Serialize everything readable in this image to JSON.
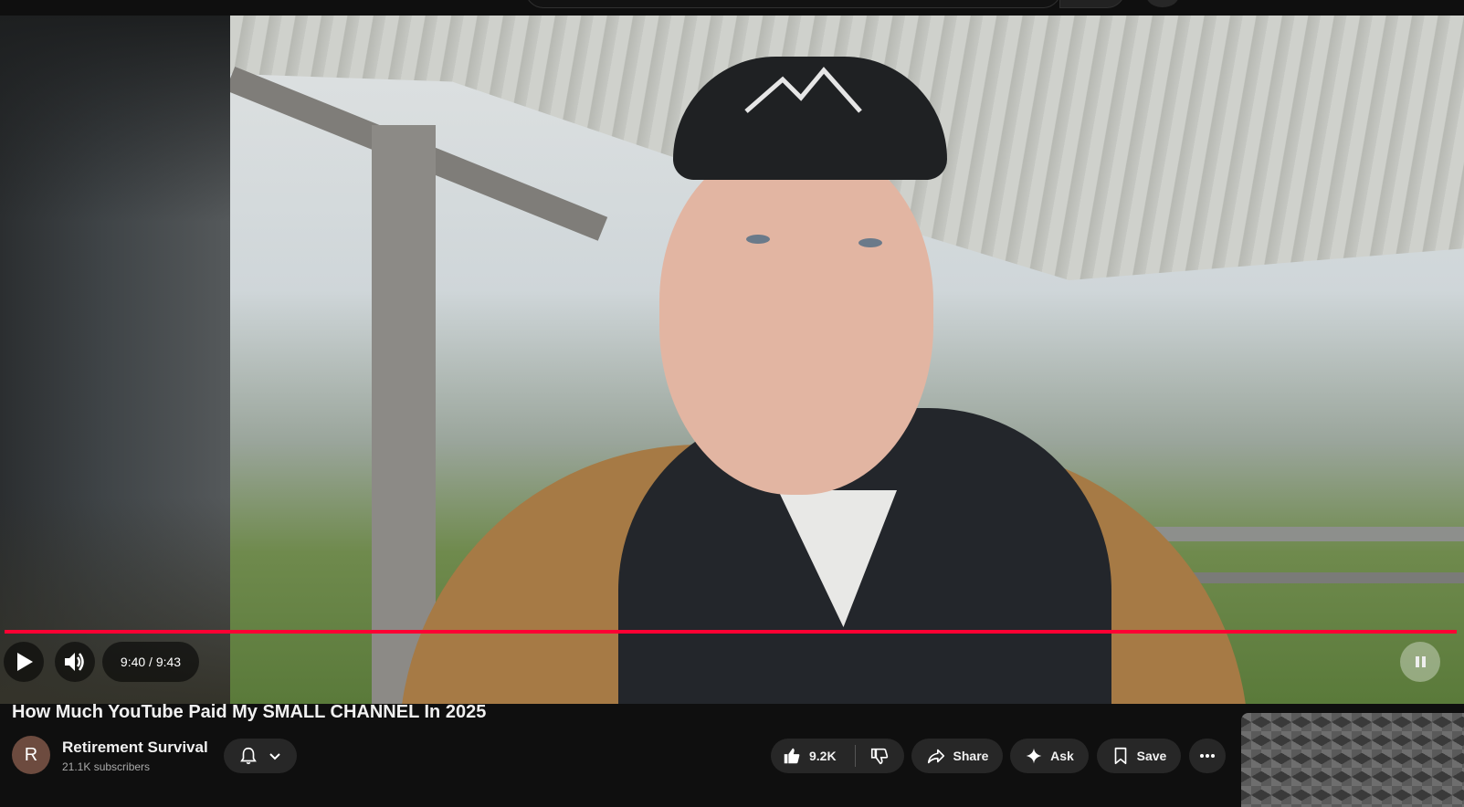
{
  "player": {
    "current_time": "9:40",
    "duration": "9:43",
    "time_display": "9:40 / 9:43",
    "progress_fraction": 0.995,
    "progress_color": "#ff0033"
  },
  "video": {
    "title": "How Much YouTube Paid My SMALL CHANNEL In 2025"
  },
  "channel": {
    "avatar_letter": "R",
    "name": "Retirement Survival",
    "subscribers": "21.1K subscribers"
  },
  "actions": {
    "like_count": "9.2K",
    "share_label": "Share",
    "ask_label": "Ask",
    "save_label": "Save"
  },
  "icons": {
    "play": "play-icon",
    "volume": "volume-icon",
    "bell": "bell-icon",
    "chevron": "chevron-down-icon",
    "like": "thumbs-up-icon",
    "dislike": "thumbs-down-icon",
    "share": "share-icon",
    "ask": "sparkle-icon",
    "save": "bookmark-icon",
    "more": "more-horizontal-icon"
  }
}
